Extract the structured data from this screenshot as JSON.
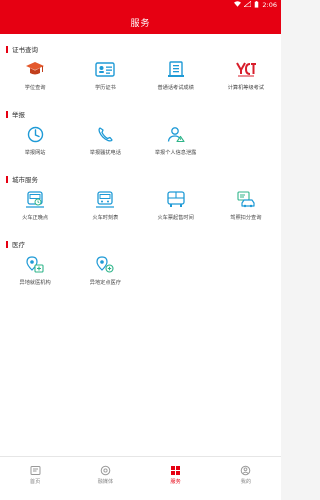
{
  "status_bar": {
    "time": "2:06"
  },
  "header": {
    "title": "服务"
  },
  "sections": [
    {
      "title": "证书查询",
      "items": [
        {
          "label": "学位查询",
          "icon": "graduation-cap-icon"
        },
        {
          "label": "学历证书",
          "icon": "id-card-icon"
        },
        {
          "label": "普通话考试成绩",
          "icon": "document-icon"
        },
        {
          "label": "计算机等级考试",
          "icon": "ncre-logo-icon"
        }
      ]
    },
    {
      "title": "举报",
      "items": [
        {
          "label": "举报网站",
          "icon": "clock-icon"
        },
        {
          "label": "举报骚扰电话",
          "icon": "phone-icon"
        },
        {
          "label": "举报个人信息泄露",
          "icon": "person-warning-icon"
        }
      ]
    },
    {
      "title": "城市服务",
      "items": [
        {
          "label": "火车正晚点",
          "icon": "train-delay-icon"
        },
        {
          "label": "火车时刻表",
          "icon": "train-schedule-icon"
        },
        {
          "label": "火车票起售时间",
          "icon": "bus-ticket-icon"
        },
        {
          "label": "驾照扣分查询",
          "icon": "car-license-icon"
        }
      ]
    },
    {
      "title": "医疗",
      "items": [
        {
          "label": "异地就医机构",
          "icon": "hospital-location-icon"
        },
        {
          "label": "异地定点医疗",
          "icon": "medical-location-icon"
        }
      ]
    }
  ],
  "tabbar": {
    "items": [
      {
        "label": "首页",
        "icon": "home-icon",
        "active": false
      },
      {
        "label": "融媒体",
        "icon": "media-icon",
        "active": false
      },
      {
        "label": "服务",
        "icon": "service-grid-icon",
        "active": true
      },
      {
        "label": "我的",
        "icon": "profile-icon",
        "active": false
      }
    ]
  },
  "colors": {
    "brand": "#e60012",
    "icon_blue": "#1e9ad6",
    "icon_green": "#2fb58a",
    "ncre_red": "#d81e2b"
  }
}
